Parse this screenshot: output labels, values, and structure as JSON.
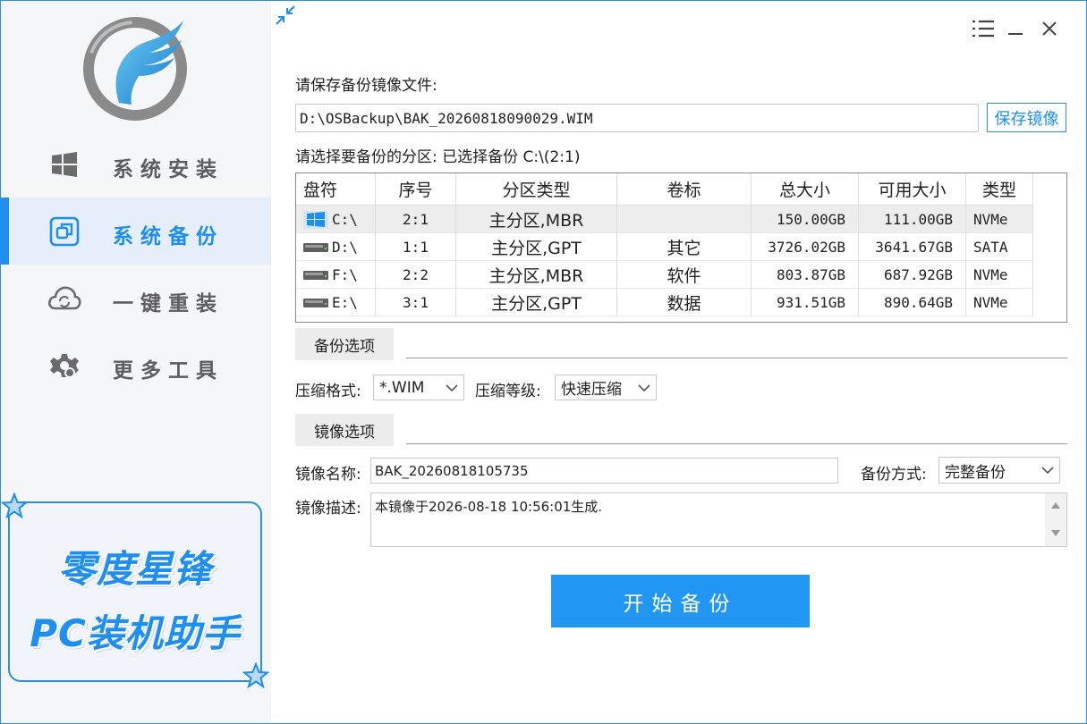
{
  "sidebar": {
    "nav": [
      {
        "label": "系统安装",
        "icon": "windows-icon"
      },
      {
        "label": "系统备份",
        "icon": "copy-icon"
      },
      {
        "label": "一键重装",
        "icon": "cloud-sync-icon"
      },
      {
        "label": "更多工具",
        "icon": "gear-icon"
      }
    ],
    "active_index": 1,
    "promo_line1": "零度星锋",
    "promo_line2": "PC装机助手"
  },
  "save_section": {
    "label": "请保存备份镜像文件:",
    "path": "D:\\OSBackup\\BAK_20260818090029.WIM",
    "save_button": "保存镜像"
  },
  "partition_section": {
    "label": "请选择要备份的分区: 已选择备份 C:\\(2:1)",
    "columns": [
      "盘符",
      "序号",
      "分区类型",
      "卷标",
      "总大小",
      "可用大小",
      "类型"
    ],
    "rows": [
      {
        "drive": "C:\\",
        "index": "2:1",
        "ptype": "主分区,MBR",
        "vol": "",
        "total": "150.00GB",
        "free": "111.00GB",
        "type": "NVMe",
        "icon": "windows-drive-icon"
      },
      {
        "drive": "D:\\",
        "index": "1:1",
        "ptype": "主分区,GPT",
        "vol": "其它",
        "total": "3726.02GB",
        "free": "3641.67GB",
        "type": "SATA",
        "icon": "disk-drive-icon"
      },
      {
        "drive": "F:\\",
        "index": "2:2",
        "ptype": "主分区,MBR",
        "vol": "软件",
        "total": "803.87GB",
        "free": "687.92GB",
        "type": "NVMe",
        "icon": "disk-drive-icon"
      },
      {
        "drive": "E:\\",
        "index": "3:1",
        "ptype": "主分区,GPT",
        "vol": "数据",
        "total": "931.51GB",
        "free": "890.64GB",
        "type": "NVMe",
        "icon": "disk-drive-icon"
      }
    ],
    "selected_row": 0
  },
  "backup_options": {
    "tab": "备份选项",
    "format_label": "压缩格式:",
    "format_value": "*.WIM",
    "level_label": "压缩等级:",
    "level_value": "快速压缩"
  },
  "image_options": {
    "tab": "镜像选项",
    "name_label": "镜像名称:",
    "name_value": "BAK_20260818105735",
    "mode_label": "备份方式:",
    "mode_value": "完整备份",
    "desc_label": "镜像描述:",
    "desc_value": "本镜像于2026-08-18 10:56:01生成."
  },
  "start_button": "开始备份",
  "colors": {
    "accent": "#1e8ef0",
    "start_button": "#2196f3",
    "active_nav_bg": "#e6eef9"
  }
}
